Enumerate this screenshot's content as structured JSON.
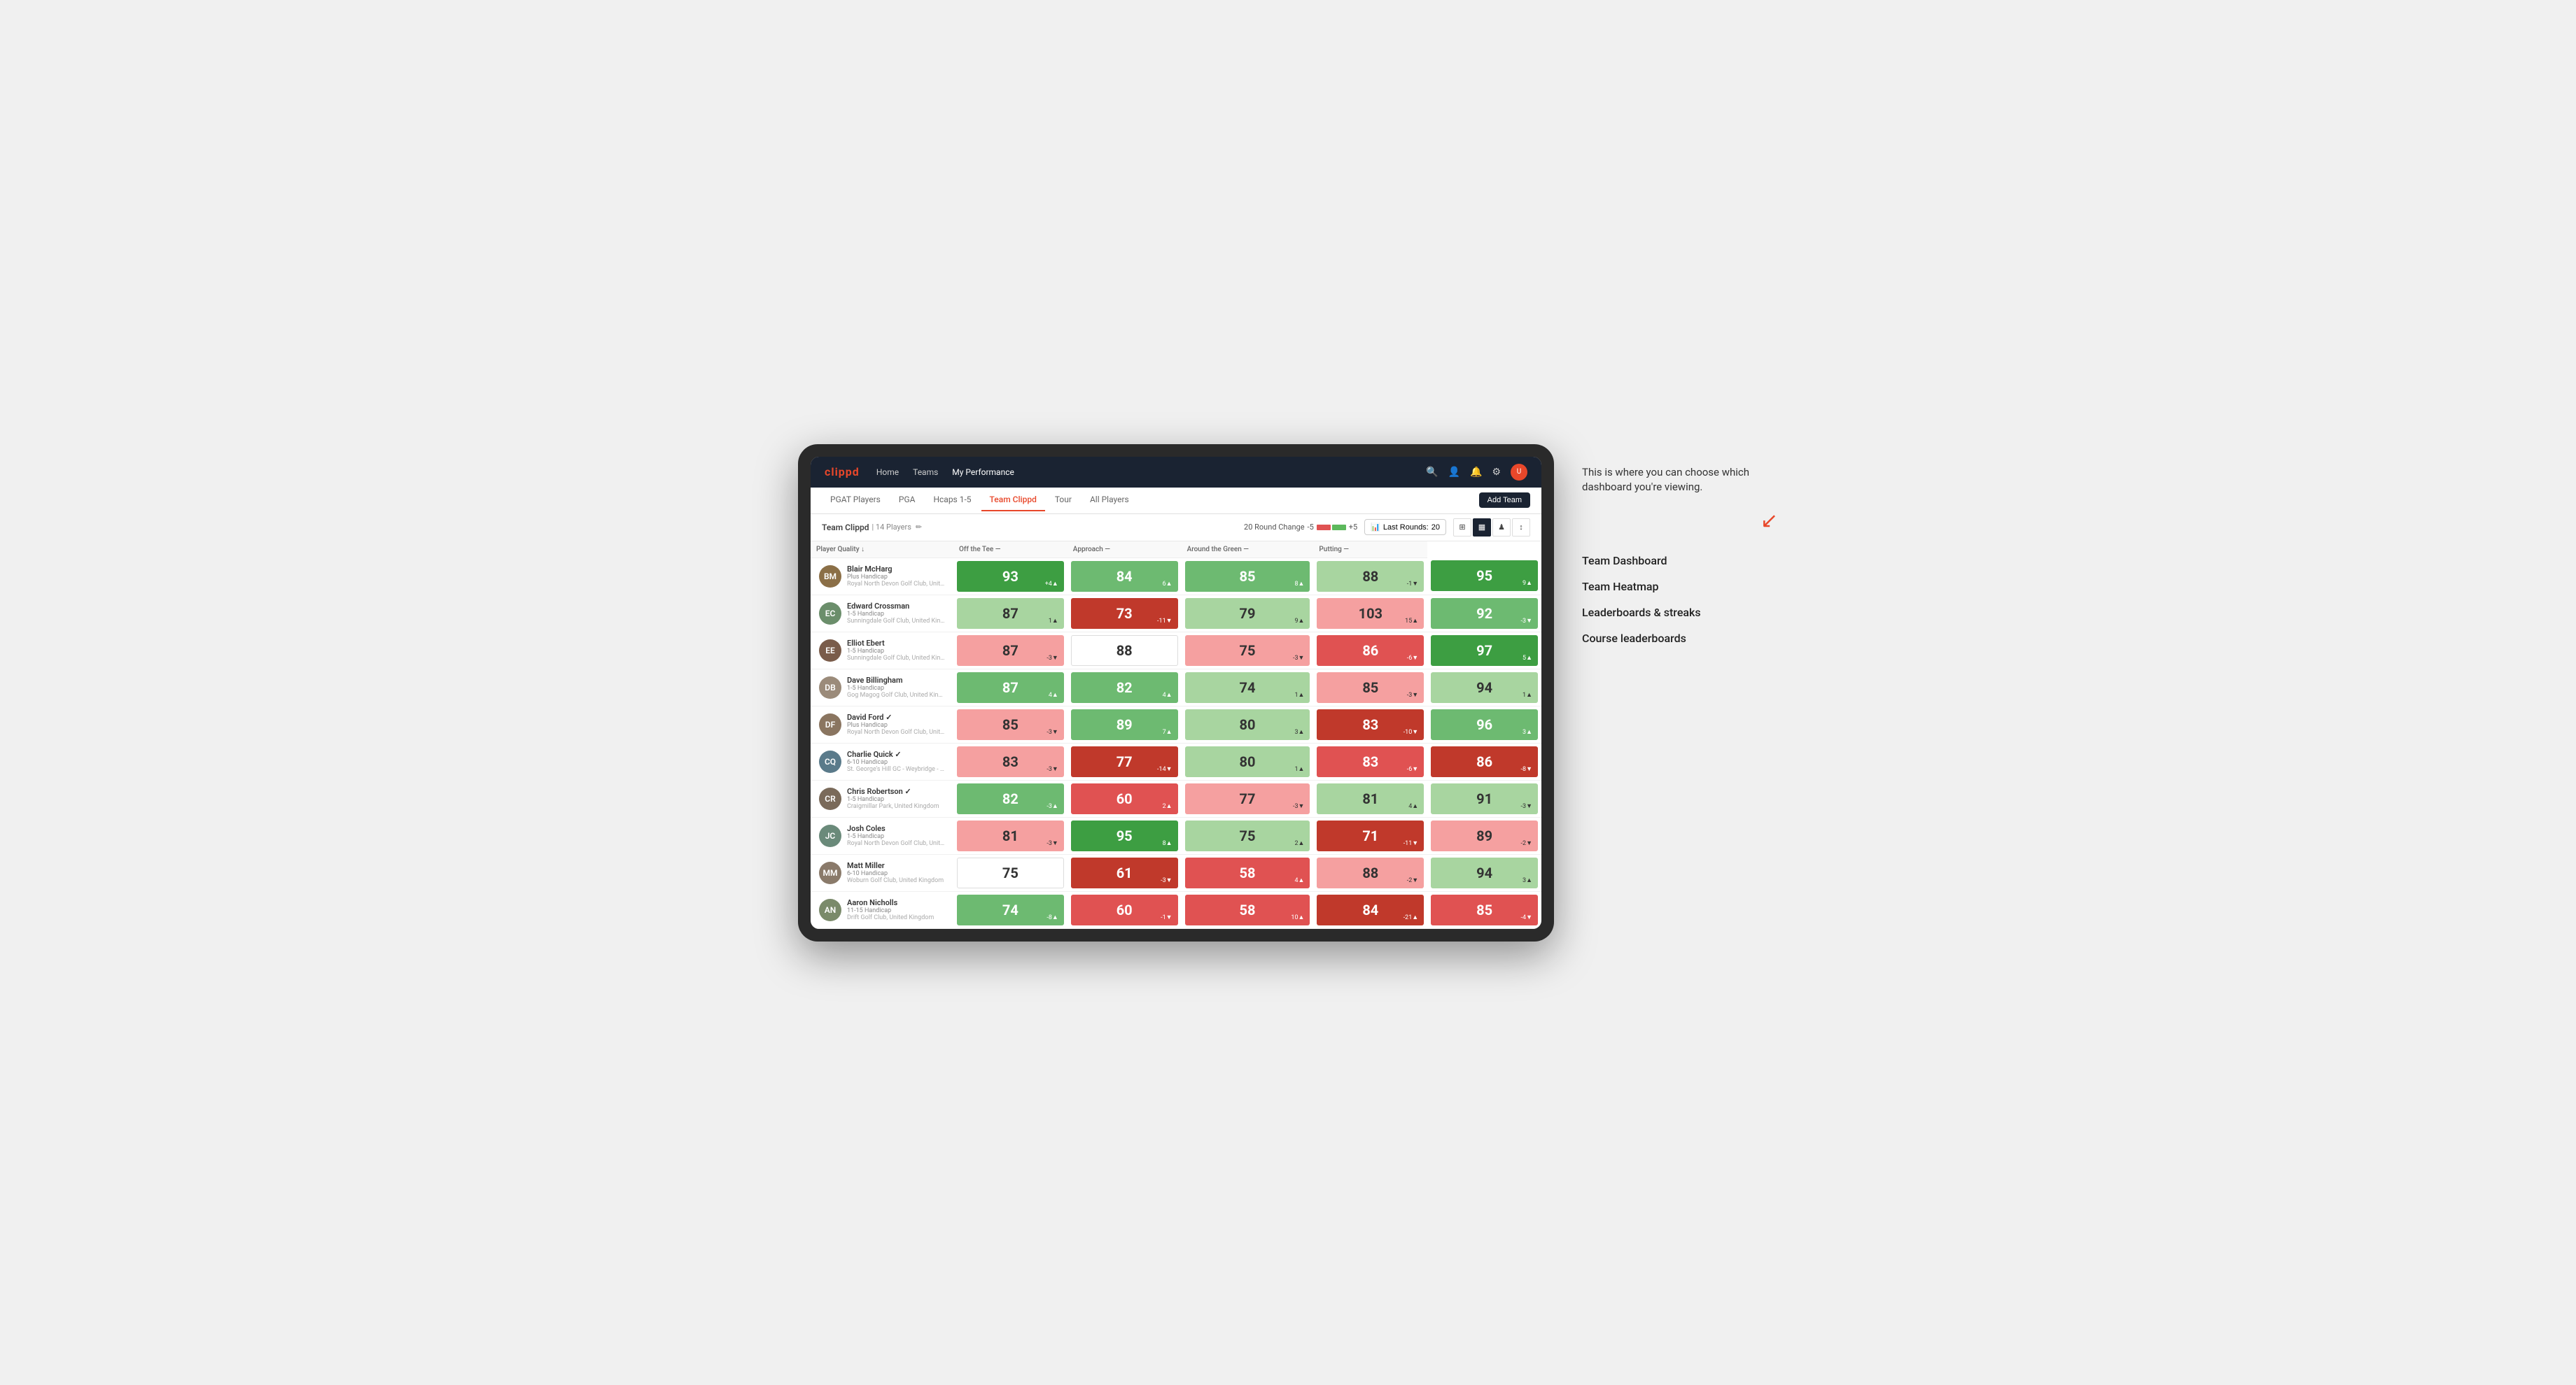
{
  "annotation": {
    "intro_text": "This is where you can choose which dashboard you're viewing.",
    "items": [
      "Team Dashboard",
      "Team Heatmap",
      "Leaderboards & streaks",
      "Course leaderboards"
    ]
  },
  "nav": {
    "logo": "clippd",
    "links": [
      {
        "label": "Home",
        "active": false
      },
      {
        "label": "Teams",
        "active": false
      },
      {
        "label": "My Performance",
        "active": true
      }
    ],
    "icons": {
      "search": "🔍",
      "user": "👤",
      "bell": "🔔",
      "settings": "⚙",
      "avatar": "U"
    }
  },
  "sub_nav": {
    "tabs": [
      {
        "label": "PGAT Players",
        "active": false
      },
      {
        "label": "PGA",
        "active": false
      },
      {
        "label": "Hcaps 1-5",
        "active": false
      },
      {
        "label": "Team Clippd",
        "active": true
      },
      {
        "label": "Tour",
        "active": false
      },
      {
        "label": "All Players",
        "active": false
      }
    ],
    "add_team_label": "Add Team"
  },
  "team_bar": {
    "name": "Team Clippd",
    "separator": "|",
    "count": "14 Players",
    "round_change_label": "20 Round Change",
    "round_neg": "-5",
    "round_pos": "+5",
    "last_rounds_label": "Last Rounds:",
    "last_rounds_value": "20",
    "view_options": [
      "grid",
      "heatmap",
      "chart",
      "sort"
    ]
  },
  "table": {
    "headers": {
      "player": "Player Quality ↓",
      "off_tee": "Off the Tee —",
      "approach": "Approach —",
      "around_green": "Around the Green —",
      "putting": "Putting —"
    },
    "players": [
      {
        "name": "Blair McHarg",
        "handicap": "Plus Handicap",
        "club": "Royal North Devon Golf Club, United Kingdom",
        "color": "#8B6F47",
        "scores": {
          "quality": {
            "value": "93",
            "change": "+4▲",
            "bg": "green-dark"
          },
          "off_tee": {
            "value": "84",
            "change": "6▲",
            "bg": "green-mid"
          },
          "approach": {
            "value": "85",
            "change": "8▲",
            "bg": "green-mid"
          },
          "around_green": {
            "value": "88",
            "change": "-1▼",
            "bg": "green-light"
          },
          "putting": {
            "value": "95",
            "change": "9▲",
            "bg": "green-dark"
          }
        }
      },
      {
        "name": "Edward Crossman",
        "handicap": "1-5 Handicap",
        "club": "Sunningdale Golf Club, United Kingdom",
        "color": "#6B8E6B",
        "scores": {
          "quality": {
            "value": "87",
            "change": "1▲",
            "bg": "green-light"
          },
          "off_tee": {
            "value": "73",
            "change": "-11▼",
            "bg": "red-dark"
          },
          "approach": {
            "value": "79",
            "change": "9▲",
            "bg": "green-light"
          },
          "around_green": {
            "value": "103",
            "change": "15▲",
            "bg": "red-light"
          },
          "putting": {
            "value": "92",
            "change": "-3▼",
            "bg": "green-mid"
          }
        }
      },
      {
        "name": "Elliot Ebert",
        "handicap": "1-5 Handicap",
        "club": "Sunningdale Golf Club, United Kingdom",
        "color": "#7A5C4A",
        "scores": {
          "quality": {
            "value": "87",
            "change": "-3▼",
            "bg": "red-light"
          },
          "off_tee": {
            "value": "88",
            "change": "",
            "bg": "white"
          },
          "approach": {
            "value": "75",
            "change": "-3▼",
            "bg": "red-light"
          },
          "around_green": {
            "value": "86",
            "change": "-6▼",
            "bg": "red-mid"
          },
          "putting": {
            "value": "97",
            "change": "5▲",
            "bg": "green-dark"
          }
        }
      },
      {
        "name": "Dave Billingham",
        "handicap": "1-5 Handicap",
        "club": "Gog Magog Golf Club, United Kingdom",
        "color": "#9B8B7A",
        "scores": {
          "quality": {
            "value": "87",
            "change": "4▲",
            "bg": "green-mid"
          },
          "off_tee": {
            "value": "82",
            "change": "4▲",
            "bg": "green-mid"
          },
          "approach": {
            "value": "74",
            "change": "1▲",
            "bg": "green-light"
          },
          "around_green": {
            "value": "85",
            "change": "-3▼",
            "bg": "red-light"
          },
          "putting": {
            "value": "94",
            "change": "1▲",
            "bg": "green-light"
          }
        }
      },
      {
        "name": "David Ford ✓",
        "handicap": "Plus Handicap",
        "club": "Royal North Devon Golf Club, United Kingdom",
        "color": "#8A7560",
        "scores": {
          "quality": {
            "value": "85",
            "change": "-3▼",
            "bg": "red-light"
          },
          "off_tee": {
            "value": "89",
            "change": "7▲",
            "bg": "green-mid"
          },
          "approach": {
            "value": "80",
            "change": "3▲",
            "bg": "green-light"
          },
          "around_green": {
            "value": "83",
            "change": "-10▼",
            "bg": "red-dark"
          },
          "putting": {
            "value": "96",
            "change": "3▲",
            "bg": "green-mid"
          }
        }
      },
      {
        "name": "Charlie Quick ✓",
        "handicap": "6-10 Handicap",
        "club": "St. George's Hill GC - Weybridge - Surrey, Uni...",
        "color": "#5A7A8A",
        "scores": {
          "quality": {
            "value": "83",
            "change": "-3▼",
            "bg": "red-light"
          },
          "off_tee": {
            "value": "77",
            "change": "-14▼",
            "bg": "red-dark"
          },
          "approach": {
            "value": "80",
            "change": "1▲",
            "bg": "green-light"
          },
          "around_green": {
            "value": "83",
            "change": "-6▼",
            "bg": "red-mid"
          },
          "putting": {
            "value": "86",
            "change": "-8▼",
            "bg": "red-dark"
          }
        }
      },
      {
        "name": "Chris Robertson ✓",
        "handicap": "1-5 Handicap",
        "club": "Craigmillar Park, United Kingdom",
        "color": "#7A6A5A",
        "scores": {
          "quality": {
            "value": "82",
            "change": "-3▲",
            "bg": "green-mid"
          },
          "off_tee": {
            "value": "60",
            "change": "2▲",
            "bg": "red-mid"
          },
          "approach": {
            "value": "77",
            "change": "-3▼",
            "bg": "red-light"
          },
          "around_green": {
            "value": "81",
            "change": "4▲",
            "bg": "green-light"
          },
          "putting": {
            "value": "91",
            "change": "-3▼",
            "bg": "green-light"
          }
        }
      },
      {
        "name": "Josh Coles",
        "handicap": "1-5 Handicap",
        "club": "Royal North Devon Golf Club, United Kingdom",
        "color": "#6A8A7A",
        "scores": {
          "quality": {
            "value": "81",
            "change": "-3▼",
            "bg": "red-light"
          },
          "off_tee": {
            "value": "95",
            "change": "8▲",
            "bg": "green-dark"
          },
          "approach": {
            "value": "75",
            "change": "2▲",
            "bg": "green-light"
          },
          "around_green": {
            "value": "71",
            "change": "-11▼",
            "bg": "red-dark"
          },
          "putting": {
            "value": "89",
            "change": "-2▼",
            "bg": "red-light"
          }
        }
      },
      {
        "name": "Matt Miller",
        "handicap": "6-10 Handicap",
        "club": "Woburn Golf Club, United Kingdom",
        "color": "#8A7A6A",
        "scores": {
          "quality": {
            "value": "75",
            "change": "",
            "bg": "white"
          },
          "off_tee": {
            "value": "61",
            "change": "-3▼",
            "bg": "red-dark"
          },
          "approach": {
            "value": "58",
            "change": "4▲",
            "bg": "red-mid"
          },
          "around_green": {
            "value": "88",
            "change": "-2▼",
            "bg": "red-light"
          },
          "putting": {
            "value": "94",
            "change": "3▲",
            "bg": "green-light"
          }
        }
      },
      {
        "name": "Aaron Nicholls",
        "handicap": "11-15 Handicap",
        "club": "Drift Golf Club, United Kingdom",
        "color": "#7A8A6A",
        "scores": {
          "quality": {
            "value": "74",
            "change": "-8▲",
            "bg": "green-mid"
          },
          "off_tee": {
            "value": "60",
            "change": "-1▼",
            "bg": "red-mid"
          },
          "approach": {
            "value": "58",
            "change": "10▲",
            "bg": "red-mid"
          },
          "around_green": {
            "value": "84",
            "change": "-21▲",
            "bg": "red-dark"
          },
          "putting": {
            "value": "85",
            "change": "-4▼",
            "bg": "red-mid"
          }
        }
      }
    ]
  }
}
